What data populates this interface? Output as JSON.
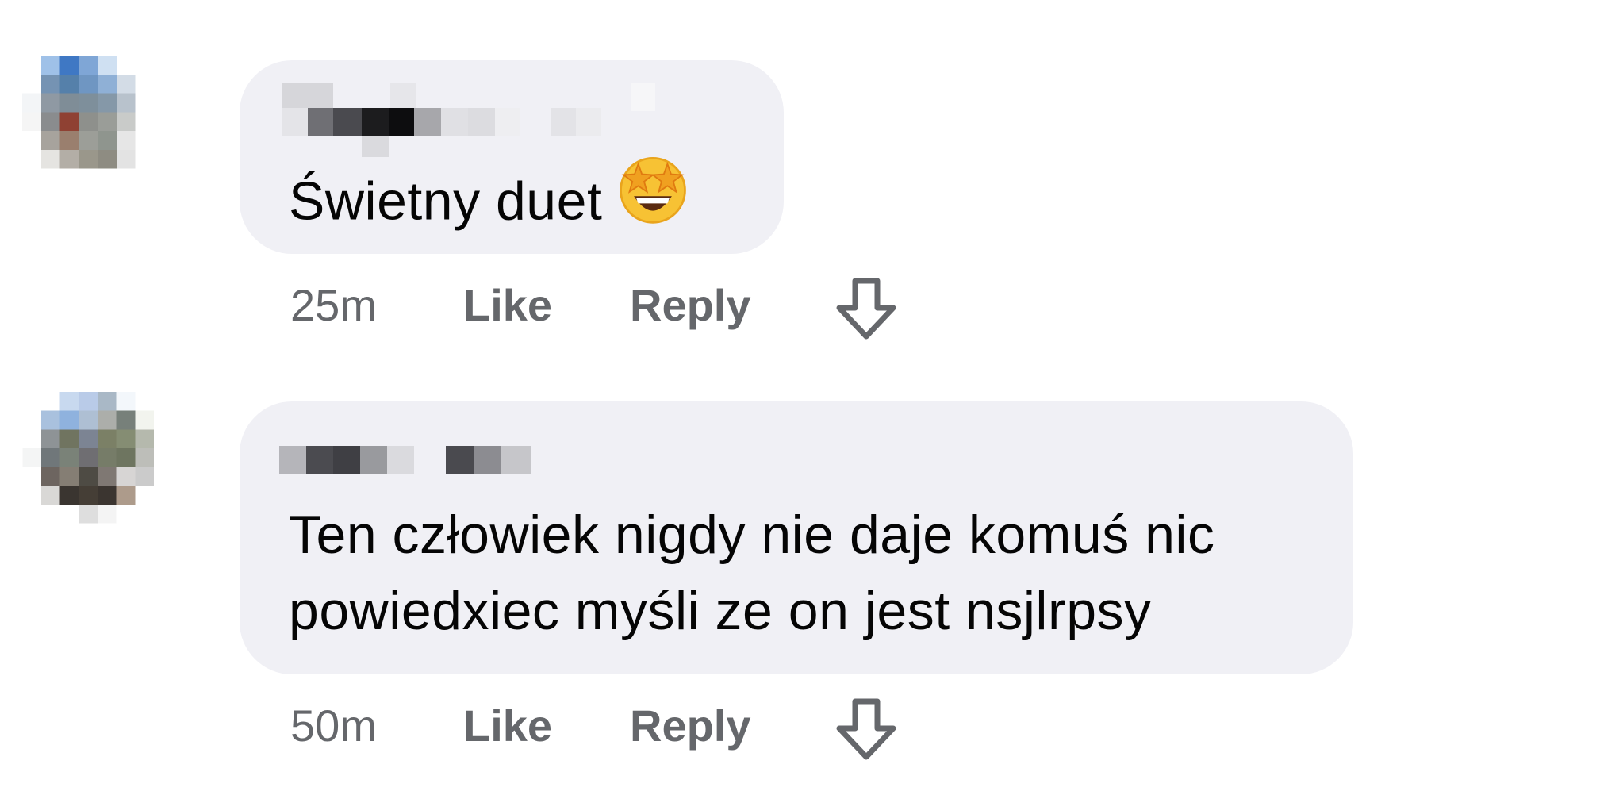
{
  "comments": [
    {
      "text": "Świetny duet",
      "emoji_icon": "star-struck-emoji",
      "time": "25m",
      "like_label": "Like",
      "reply_label": "Reply",
      "downvote_icon": "arrow-down-outline-icon"
    },
    {
      "text_lines": [
        "Ten człowiek nigdy nie daje komuś nic",
        "powiedxiec myśli ze on jest nsjlrpsy"
      ],
      "time": "50m",
      "like_label": "Like",
      "reply_label": "Reply",
      "downvote_icon": "arrow-down-outline-icon"
    }
  ],
  "colors": {
    "bubble": "#f0f0f5",
    "meta_text": "#65676b",
    "body_text": "#050505"
  }
}
